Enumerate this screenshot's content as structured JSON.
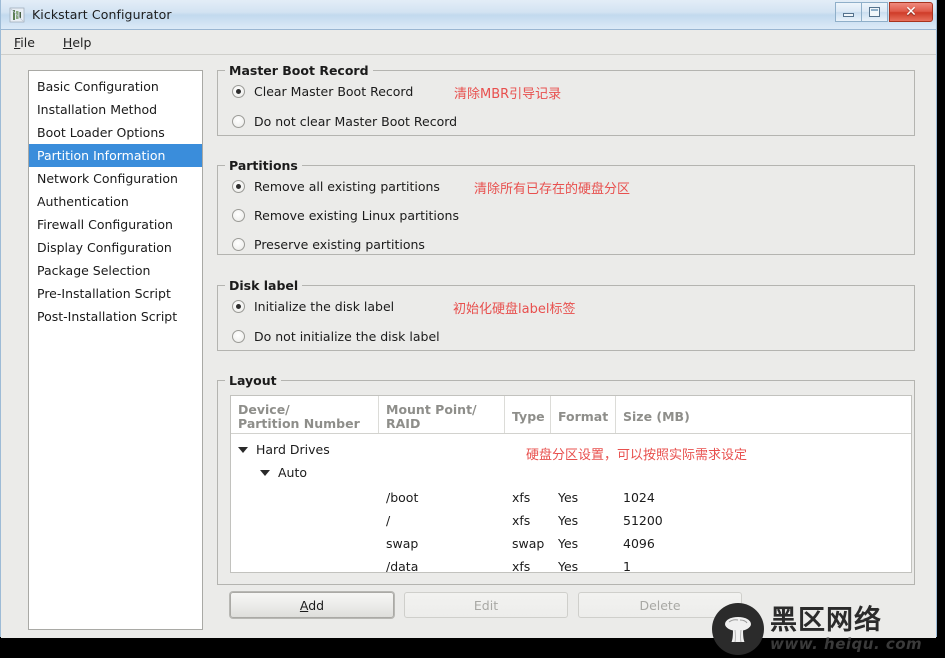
{
  "window": {
    "title": "Kickstart Configurator",
    "icon": "app-icon",
    "controls": {
      "minimize": "minimize",
      "maximize": "maximize",
      "close": "close"
    }
  },
  "menubar": {
    "items": [
      {
        "label": "File",
        "mnemonic": "F"
      },
      {
        "label": "Help",
        "mnemonic": "H"
      }
    ]
  },
  "sidebar": {
    "items": [
      {
        "label": "Basic Configuration",
        "selected": false
      },
      {
        "label": "Installation Method",
        "selected": false
      },
      {
        "label": "Boot Loader Options",
        "selected": false
      },
      {
        "label": "Partition Information",
        "selected": true
      },
      {
        "label": "Network Configuration",
        "selected": false
      },
      {
        "label": "Authentication",
        "selected": false
      },
      {
        "label": "Firewall Configuration",
        "selected": false
      },
      {
        "label": "Display Configuration",
        "selected": false
      },
      {
        "label": "Package Selection",
        "selected": false
      },
      {
        "label": "Pre-Installation Script",
        "selected": false
      },
      {
        "label": "Post-Installation Script",
        "selected": false
      }
    ]
  },
  "mbr_group": {
    "title": "Master Boot Record",
    "annotation": "清除MBR引导记录",
    "options": [
      {
        "label": "Clear Master Boot Record",
        "selected": true
      },
      {
        "label": "Do not clear Master Boot Record",
        "selected": false
      }
    ]
  },
  "partitions_group": {
    "title": "Partitions",
    "annotation": "清除所有已存在的硬盘分区",
    "options": [
      {
        "label": "Remove all existing partitions",
        "selected": true
      },
      {
        "label": "Remove existing Linux partitions",
        "selected": false
      },
      {
        "label": "Preserve existing partitions",
        "selected": false
      }
    ]
  },
  "disklabel_group": {
    "title": "Disk label",
    "annotation": "初始化硬盘label标签",
    "options": [
      {
        "label": "Initialize the disk label",
        "selected": true
      },
      {
        "label": "Do not initialize the disk label",
        "selected": false
      }
    ]
  },
  "layout_group": {
    "title": "Layout",
    "annotation": "硬盘分区设置，可以按照实际需求设定",
    "columns": [
      {
        "line1": "Device/",
        "line2": "Partition Number"
      },
      {
        "line1": "Mount Point/",
        "line2": "RAID"
      },
      {
        "line1": "Type",
        "line2": ""
      },
      {
        "line1": "Format",
        "line2": ""
      },
      {
        "line1": "Size (MB)",
        "line2": ""
      }
    ],
    "tree": [
      {
        "level": 0,
        "expander": true,
        "device": "Hard Drives",
        "mount": "",
        "type": "",
        "format": "",
        "size": ""
      },
      {
        "level": 1,
        "expander": true,
        "device": "Auto",
        "mount": "",
        "type": "",
        "format": "",
        "size": ""
      },
      {
        "level": 2,
        "expander": false,
        "device": "",
        "mount": "/boot",
        "type": "xfs",
        "format": "Yes",
        "size": "1024"
      },
      {
        "level": 2,
        "expander": false,
        "device": "",
        "mount": "/",
        "type": "xfs",
        "format": "Yes",
        "size": "51200"
      },
      {
        "level": 2,
        "expander": false,
        "device": "",
        "mount": "swap",
        "type": "swap",
        "format": "Yes",
        "size": "4096"
      },
      {
        "level": 2,
        "expander": false,
        "device": "",
        "mount": "/data",
        "type": "xfs",
        "format": "Yes",
        "size": "1"
      }
    ],
    "buttons": [
      {
        "label": "Add",
        "mnemonic": "A",
        "enabled": true
      },
      {
        "label": "Edit",
        "mnemonic": "",
        "enabled": false
      },
      {
        "label": "Delete",
        "mnemonic": "",
        "enabled": false
      }
    ]
  },
  "watermark": {
    "cn": "黑区网络",
    "url": "www. heiqu. com",
    "logo": "mushroom-logo"
  },
  "colors": {
    "selection_blue": "#3a8ddb",
    "annotation_red": "#e8504e",
    "window_bg": "#ebebe9",
    "close_red": "#cf3c29"
  }
}
